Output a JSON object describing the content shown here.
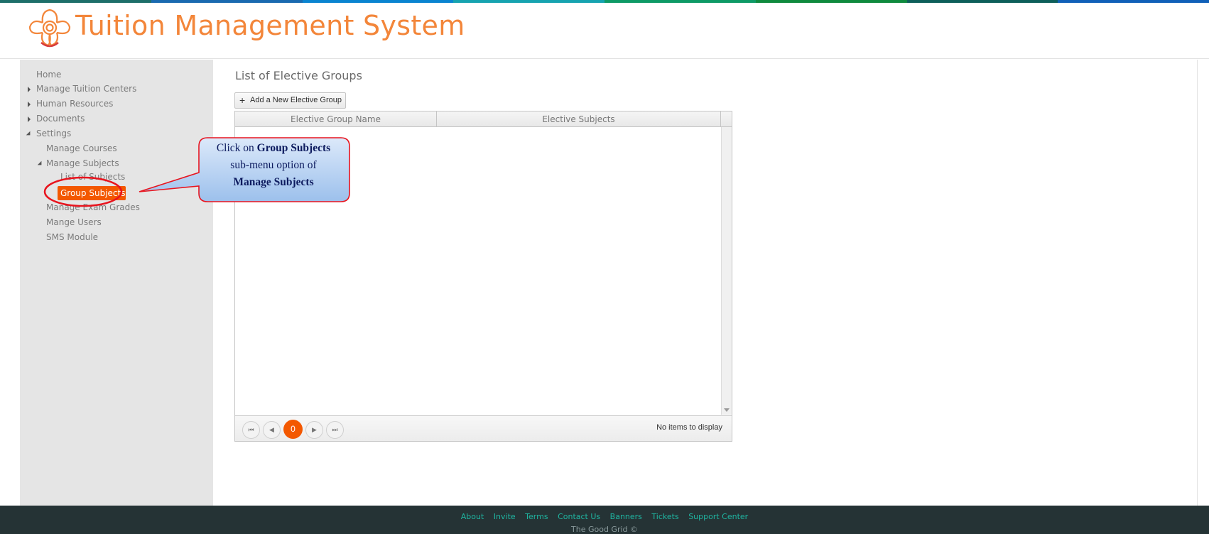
{
  "top_strip_colors": [
    "#1e6f6a",
    "#1a6ab0",
    "#0a84d0",
    "#16a3b0",
    "#0e9a66",
    "#0f8a3e",
    "#0e5f5a",
    "#1060b8"
  ],
  "header": {
    "logo_icon": "flower-logo-icon",
    "title": "Tuition Management System"
  },
  "sidebar": {
    "home": "Home",
    "manage_tuition_centers": "Manage Tuition Centers",
    "human_resources": "Human Resources",
    "documents": "Documents",
    "settings": "Settings",
    "manage_courses": "Manage Courses",
    "manage_subjects": "Manage Subjects",
    "list_of_subjects": "List of Subjects",
    "group_subjects": "Group Subjects",
    "manage_exam_grades": "Manage Exam Grades",
    "mange_users": "Mange Users",
    "sms_module": "SMS Module"
  },
  "main": {
    "page_title": "List of Elective Groups",
    "add_button_label": "Add a New Elective Group",
    "grid": {
      "columns": [
        "Elective Group Name",
        "Elective Subjects"
      ],
      "rows": [],
      "current_page": "0",
      "pager_info": "No items to display"
    }
  },
  "callout": {
    "line1_prefix": "Click on ",
    "line1_bold": "Group Subjects",
    "line2": "sub-menu option of",
    "line3_bold": "Manage Subjects",
    "accent_color": "#e8141e"
  },
  "footer": {
    "links": [
      "About",
      "Invite",
      "Terms",
      "Contact Us",
      "Banners",
      "Tickets",
      "Support Center"
    ],
    "copyright": "The Good Grid ©"
  }
}
